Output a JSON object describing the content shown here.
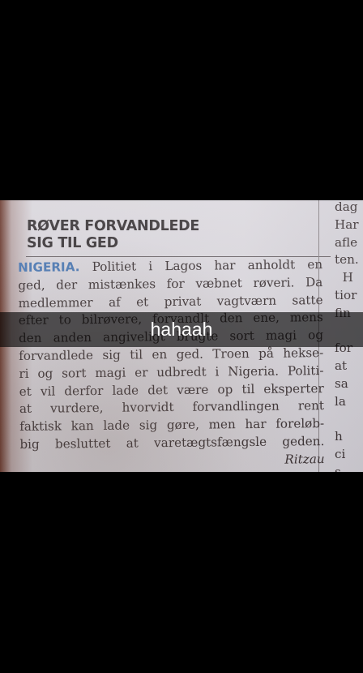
{
  "caption": "hahaah",
  "article": {
    "headline": [
      "RØVER FORVANDLEDE",
      "SIG TIL GED"
    ],
    "lead": "NIGERIA.",
    "lines": [
      " Politiet i Lagos har anholdt en",
      "ged, der mistænkes for væbnet røveri. Da",
      "medlemmer af et privat vagtværn satte",
      "efter to bilrøvere, forvandlt den ene, mens",
      "den anden angiveligt brugte sort magi og",
      "forvandlede sig til en ged. Troen på hekse-",
      "ri og sort magi er udbredt i Nigeria. Politi-",
      "et vil derfor lade det være op til eksperter",
      "at vurdere, hvorvidt forvandlingen rent",
      "faktisk kan lade sig gøre, men har foreløb-",
      "big besluttet at varetægtsfængsle geden."
    ],
    "byline": "Ritzau",
    "lead_color": "#4a78b4"
  },
  "side_column": [
    "dag",
    "Har",
    "afle",
    "ten.",
    "  H",
    "tior",
    "fin",
    "",
    "for",
    "at",
    "sa",
    "la",
    "",
    "h",
    "ci",
    "s"
  ]
}
